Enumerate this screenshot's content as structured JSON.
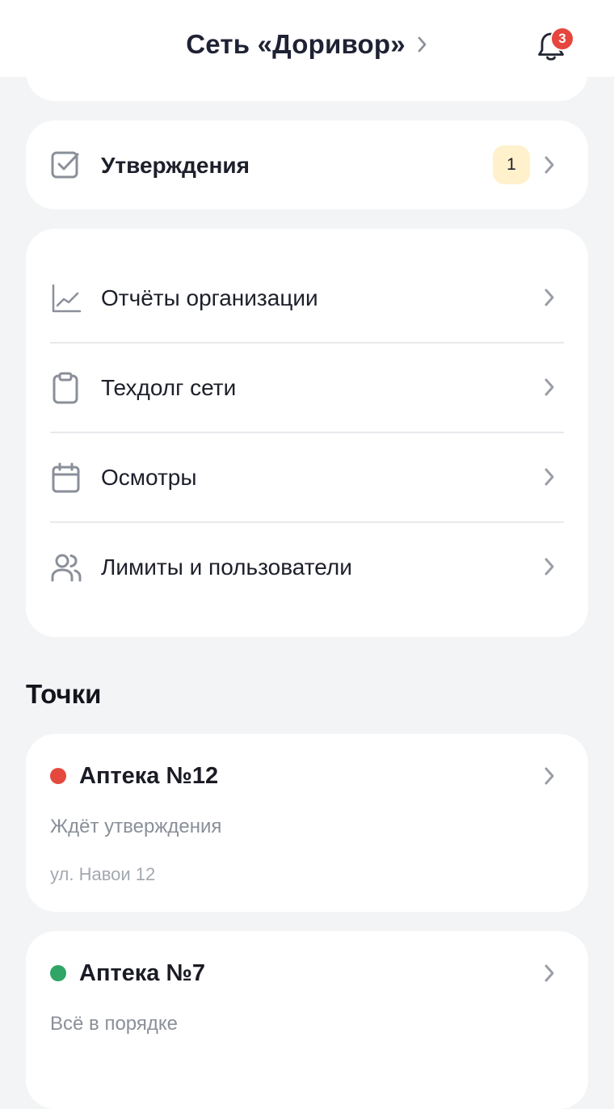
{
  "header": {
    "title": "Сеть «Доривор»",
    "notifications_count": "3"
  },
  "approvals": {
    "label": "Утверждения",
    "count": "1"
  },
  "menu": {
    "items": [
      {
        "label": "Отчёты организации",
        "icon": "chart-line-icon"
      },
      {
        "label": "Техдолг сети",
        "icon": "clipboard-icon"
      },
      {
        "label": "Осмотры",
        "icon": "calendar-icon"
      },
      {
        "label": "Лимиты и пользователи",
        "icon": "users-icon"
      }
    ]
  },
  "points": {
    "section_title": "Точки",
    "items": [
      {
        "name": "Аптека №12",
        "status": "Ждёт утверждения",
        "address": "ул. Навои 12",
        "status_color": "#e5483d"
      },
      {
        "name": "Аптека №7",
        "status": "Всё в порядке",
        "address": "",
        "status_color": "#2fa566"
      }
    ]
  },
  "colors": {
    "background": "#f2f4f5",
    "card": "#ffffff",
    "badge_red": "#e5463d",
    "count_badge_bg": "#fff1cc",
    "icon_gray": "#8a8f99",
    "chevron_gray": "#9a9ea6"
  }
}
